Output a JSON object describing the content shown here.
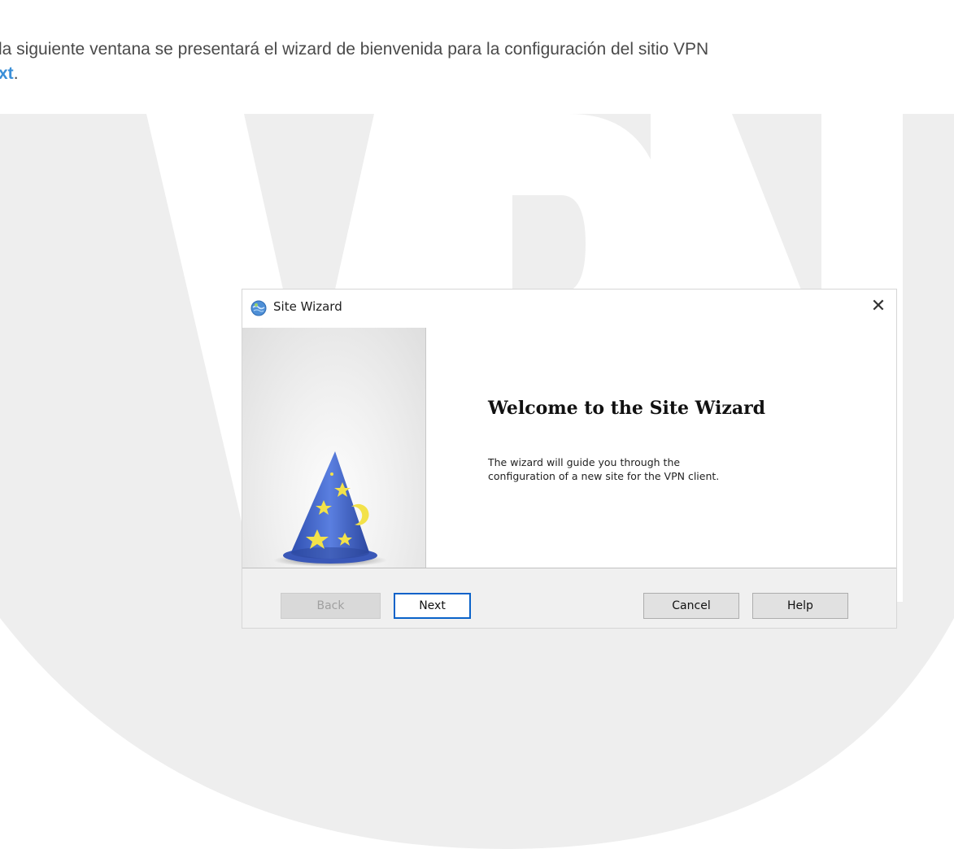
{
  "intro": {
    "line1": "la siguiente ventana se presentará el wizard de bienvenida para la configuración del sitio VPN",
    "line2_highlight": "xt",
    "line2_rest": "."
  },
  "watermark": {
    "text": "VPN",
    "color": "#ececec"
  },
  "dialog": {
    "title": "Site Wizard",
    "close_glyph": "✕",
    "welcome_heading": "Welcome to the Site Wizard",
    "description": "The wizard will guide you through the configuration of a new site for the VPN client.",
    "buttons": {
      "back": "Back",
      "next": "Next",
      "cancel": "Cancel",
      "help": "Help"
    },
    "icons": {
      "title_icon": "globe-icon",
      "side_image": "wizard-hat-icon"
    }
  },
  "colors": {
    "highlight": "#3a8fd8",
    "primary_button_border": "#0a62c9",
    "hat_blue": "#3f63c9",
    "hat_stars": "#f3e24a"
  }
}
